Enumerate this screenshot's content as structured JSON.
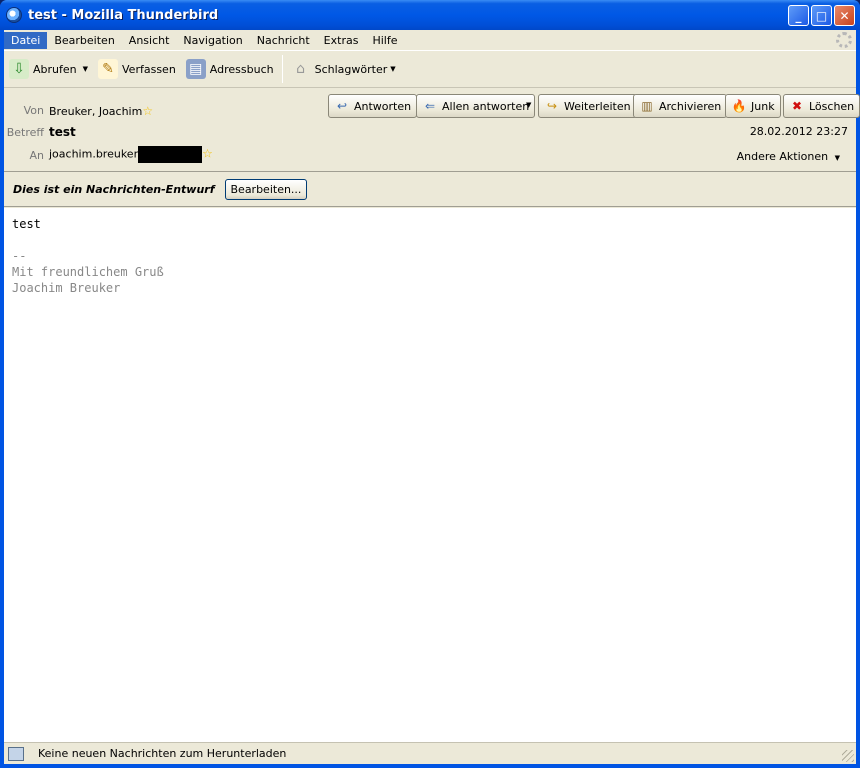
{
  "window": {
    "title": "test - Mozilla Thunderbird"
  },
  "menu": [
    "Datei",
    "Bearbeiten",
    "Ansicht",
    "Navigation",
    "Nachricht",
    "Extras",
    "Hilfe"
  ],
  "toolbar": {
    "get_mail": "Abrufen",
    "compose": "Verfassen",
    "address_book": "Adressbuch",
    "tags": "Schlagwörter"
  },
  "header": {
    "from_label": "Von",
    "from_value": "Breuker, Joachim",
    "subject_label": "Betreff",
    "subject_value": "test",
    "to_label": "An",
    "to_value": "joachim.breuker",
    "date": "28.02.2012 23:27",
    "other_actions": "Andere Aktionen"
  },
  "actions": {
    "reply": "Antworten",
    "reply_all": "Allen antworten",
    "forward": "Weiterleiten",
    "archive": "Archivieren",
    "junk": "Junk",
    "delete": "Löschen"
  },
  "draft": {
    "notice": "Dies ist ein Nachrichten-Entwurf",
    "edit_button": "Bearbeiten..."
  },
  "message": {
    "body": "test",
    "sig_sep": "--",
    "sig_line1": "Mit freundlichem Gruß",
    "sig_line2": "Joachim Breuker"
  },
  "status": {
    "text": "Keine neuen Nachrichten zum Herunterladen"
  }
}
